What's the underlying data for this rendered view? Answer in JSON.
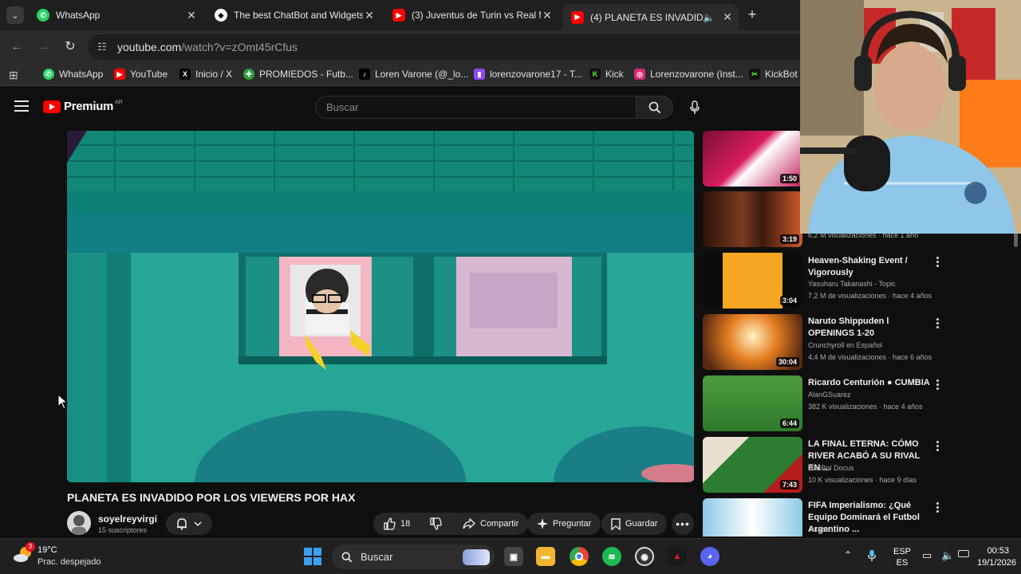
{
  "browser": {
    "tabs": [
      {
        "title": "WhatsApp",
        "favicon": "whatsapp-icon",
        "active": false
      },
      {
        "title": "The best ChatBot and Widgets",
        "favicon": "streamelements-icon",
        "active": false
      },
      {
        "title": "(3) Juventus de Turin vs Real M",
        "favicon": "youtube-icon",
        "active": false
      },
      {
        "title": "(4) PLANETA ES INVADIDO",
        "favicon": "youtube-icon",
        "active": true
      }
    ],
    "url_host": "youtube.com",
    "url_path": "/watch?v=zOmt45rCfus",
    "bookmarks": [
      {
        "label": "WhatsApp",
        "icon": "whatsapp-icon",
        "color": "#25d366"
      },
      {
        "label": "YouTube",
        "icon": "youtube-icon",
        "color": "#ff0000"
      },
      {
        "label": "Inicio / X",
        "icon": "x-icon",
        "color": "#000000"
      },
      {
        "label": "PROMIEDOS - Futb...",
        "icon": "promiedos-icon",
        "color": "#2e9e3e"
      },
      {
        "label": "Loren Varone (@_lo...",
        "icon": "tiktok-icon",
        "color": "#000000"
      },
      {
        "label": "lorenzovarone17 - T...",
        "icon": "twitch-icon",
        "color": "#9146ff"
      },
      {
        "label": "Kick",
        "icon": "kick-icon",
        "color": "#53fc18"
      },
      {
        "label": "Lorenzovarone (Inst...",
        "icon": "instagram-icon",
        "color": "#d62976"
      },
      {
        "label": "KickBot",
        "icon": "kickbot-icon",
        "color": "#53fc18"
      }
    ]
  },
  "youtube": {
    "logo_text": "Premium",
    "logo_region": "AR",
    "search_placeholder": "Buscar",
    "video": {
      "title": "PLANETA ES INVADIDO POR LOS VIEWERS POR HAX",
      "channel": "soyelreyvirgi",
      "subscribers": "15 suscriptores",
      "likes": "18",
      "share_label": "Compartir",
      "ask_label": "Preguntar",
      "save_label": "Guardar"
    },
    "recommendations": [
      {
        "title": "",
        "channel": "",
        "meta": "",
        "duration": "1:50",
        "thumb_color": "#c2185b"
      },
      {
        "title": "",
        "channel": "",
        "meta": "6,2 M visualizaciones · hace 1 año",
        "duration": "3:19",
        "thumb_color": "#3e1f12"
      },
      {
        "title": "Heaven-Shaking Event / Vigorously",
        "channel": "Yasuharu Takanashi - Topic",
        "meta": "7,2 M de visualizaciones · hace 4 años",
        "duration": "3:04",
        "thumb_color": "#f39c12"
      },
      {
        "title": "Naruto Shippuden l OPENINGS 1-20",
        "channel": "Crunchyroll en Español",
        "meta": "4,4 M de visualizaciones · hace 6 años",
        "duration": "30:04",
        "thumb_color": "#e67e22"
      },
      {
        "title": "Ricardo Centurión ● CUMBIA",
        "channel": "AlanGSuarez",
        "meta": "382 K visualizaciones · hace 4 años",
        "duration": "6:44",
        "thumb_color": "#3f8f3a"
      },
      {
        "title": "LA FINAL ETERNA: CÓMO RIVER ACABÓ A SU RIVAL EN ...",
        "channel": "GusBol Docus",
        "meta": "10 K visualizaciones · hace 9 días",
        "duration": "7:43",
        "thumb_color": "#2e7d32"
      },
      {
        "title": "FIFA Imperialismo: ¿Qué Equipo Dominará el Futbol Argentino ...",
        "channel": "Jotabe",
        "meta": "",
        "duration": "",
        "thumb_color": "#8ecae6"
      }
    ]
  },
  "taskbar": {
    "temperature": "19°C",
    "weather": "Prac. despejado",
    "weather_badge": "3",
    "search_label": "Buscar",
    "lang_top": "ESP",
    "lang_bottom": "ES",
    "time": "00:53",
    "date": "19/1/2026"
  }
}
